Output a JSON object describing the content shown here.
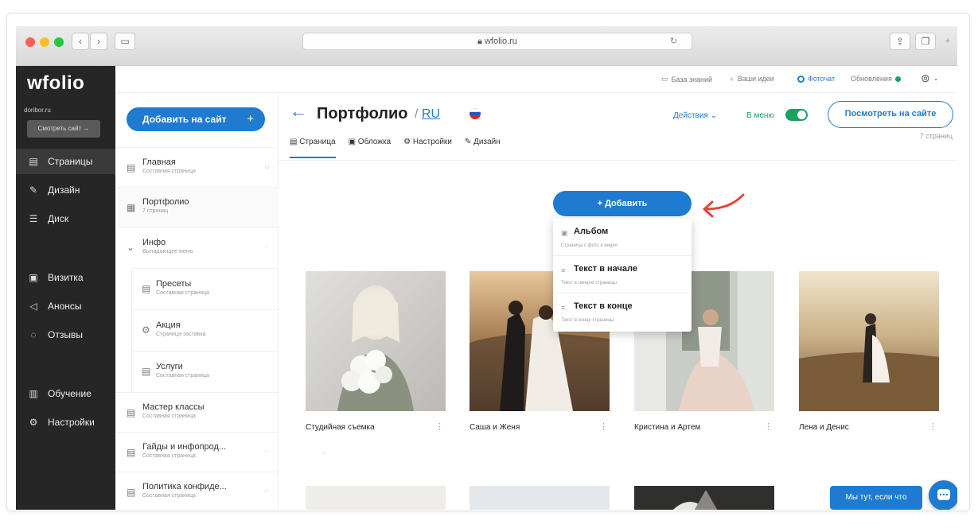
{
  "browser": {
    "url": "wfolio.ru",
    "traffic_lights": [
      "#fe5f57",
      "#febc2e",
      "#28c840"
    ],
    "icons": [
      "back-arrow-icon",
      "forward-arrow-icon",
      "sidebar-toggle-icon",
      "reload-icon",
      "share-icon",
      "tabs-icon",
      "new-tab-icon"
    ]
  },
  "app": {
    "logo": "wfolio",
    "domain": "doribor.ru",
    "view_site": "Смотреть сайт →"
  },
  "nav": {
    "items": [
      {
        "label": "Страницы",
        "icon": "page-icon",
        "active": true
      },
      {
        "label": "Дизайн",
        "icon": "brush-icon",
        "active": false
      },
      {
        "label": "Диск",
        "icon": "database-icon",
        "active": false
      },
      {
        "label": "Визитка",
        "icon": "card-icon",
        "active": false
      },
      {
        "label": "Анонсы",
        "icon": "megaphone-icon",
        "active": false
      },
      {
        "label": "Отзывы",
        "icon": "chat-icon",
        "active": false
      },
      {
        "label": "Обучение",
        "icon": "book-icon",
        "active": false
      },
      {
        "label": "Настройки",
        "icon": "gear-icon",
        "active": false
      }
    ]
  },
  "topbar": {
    "knowledge": "База знаний",
    "ideas": "Ваши идеи",
    "fotochat": "Фоточат",
    "updates": "Обновления"
  },
  "pages_panel": {
    "add_button": "Добавить на сайт",
    "add_plus": "+",
    "items": [
      {
        "title": "Главная",
        "subtitle": "Составная страница"
      },
      {
        "title": "Портфолио",
        "subtitle": "7 страниц"
      },
      {
        "title": "Инфо",
        "subtitle": "Выпадающее меню"
      },
      {
        "title": "Пресеты",
        "subtitle": "Составная страница"
      },
      {
        "title": "Акция",
        "subtitle": "Страница-заставка"
      },
      {
        "title": "Услуги",
        "subtitle": "Составная страница"
      },
      {
        "title": "Мастер классы",
        "subtitle": "Составная страница"
      },
      {
        "title": "Гайды и инфопрод...",
        "subtitle": "Составная страница"
      },
      {
        "title": "Политика конфиде...",
        "subtitle": "Составная страница"
      }
    ]
  },
  "main": {
    "back": "←",
    "title": "Портфолио",
    "lang": "RU",
    "actions": "Действия ⌄",
    "in_menu": "В меню",
    "in_menu_enabled": true,
    "view_button": "Посмотреть на сайте",
    "tabs": [
      "Страница",
      "Обложка",
      "Настройки",
      "Дизайн"
    ],
    "active_tab": "Страница",
    "page_count": "7 страниц",
    "add_button": "+ Добавить",
    "dropdown": [
      {
        "title": "Альбом",
        "subtitle": "Страница с фото и видео",
        "icon": "album-icon"
      },
      {
        "title": "Текст в начале",
        "subtitle": "Текст в начале страницы",
        "icon": "text-icon"
      },
      {
        "title": "Текст в конце",
        "subtitle": "Текст в конце страницы",
        "icon": "text-icon"
      }
    ],
    "cards": [
      {
        "title": "Студийная съемка",
        "menu": "⋮"
      },
      {
        "title": "Саша и Женя",
        "menu": "⋮"
      },
      {
        "title": "Кристина и Артем",
        "menu": "⋮"
      },
      {
        "title": "Лена и Денис",
        "menu": "⋮"
      }
    ],
    "chat_bubble": "Мы тут, если что"
  },
  "colors": {
    "accent": "#1f7bd1",
    "green": "#19a15f",
    "sidebar": "#262626"
  }
}
